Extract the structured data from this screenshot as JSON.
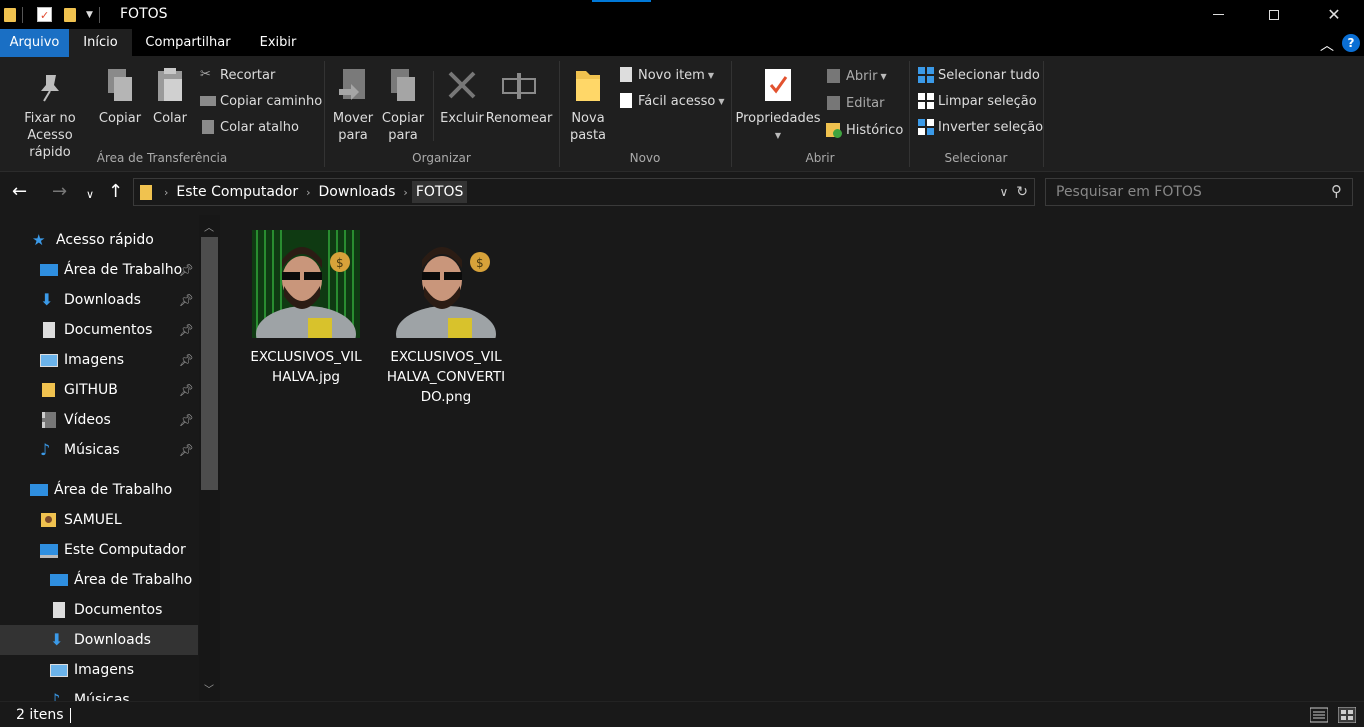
{
  "window": {
    "title": "FOTOS"
  },
  "tabs": [
    {
      "label": "Arquivo"
    },
    {
      "label": "Início"
    },
    {
      "label": "Compartilhar"
    },
    {
      "label": "Exibir"
    }
  ],
  "help_label": "?",
  "ribbon": {
    "clipboard": {
      "label": "Área de Transferência",
      "pin": "Fixar no\nAcesso rápido",
      "copy": "Copiar",
      "paste": "Colar",
      "cut": "Recortar",
      "copy_path": "Copiar caminho",
      "paste_shortcut": "Colar atalho"
    },
    "organize": {
      "label": "Organizar",
      "move_to": "Mover\npara",
      "copy_to": "Copiar\npara",
      "delete": "Excluir",
      "rename": "Renomear"
    },
    "new": {
      "label": "Novo",
      "new_folder": "Nova\npasta",
      "new_item": "Novo item",
      "easy_access": "Fácil acesso"
    },
    "open": {
      "label": "Abrir",
      "properties": "Propriedades",
      "open": "Abrir",
      "edit": "Editar",
      "history": "Histórico"
    },
    "select": {
      "label": "Selecionar",
      "select_all": "Selecionar tudo",
      "select_none": "Limpar seleção",
      "invert": "Inverter seleção"
    }
  },
  "breadcrumb": [
    "Este Computador",
    "Downloads",
    "FOTOS"
  ],
  "search": {
    "placeholder": "Pesquisar em FOTOS"
  },
  "sidebar": {
    "items": [
      {
        "label": "Acesso rápido",
        "icon": "star-icon",
        "pinned": false
      },
      {
        "label": "Área de Trabalho",
        "icon": "desktop-icon",
        "pinned": true
      },
      {
        "label": "Downloads",
        "icon": "download-icon",
        "pinned": true
      },
      {
        "label": "Documentos",
        "icon": "document-icon",
        "pinned": true
      },
      {
        "label": "Imagens",
        "icon": "picture-icon",
        "pinned": true
      },
      {
        "label": "GITHUB",
        "icon": "folder-icon",
        "pinned": true
      },
      {
        "label": "Vídeos",
        "icon": "video-icon",
        "pinned": true
      },
      {
        "label": "Músicas",
        "icon": "music-icon",
        "pinned": true
      },
      {
        "label": "Área de Trabalho",
        "icon": "desktop-icon",
        "pinned": false
      },
      {
        "label": "SAMUEL",
        "icon": "user-folder-icon",
        "pinned": false
      },
      {
        "label": "Este Computador",
        "icon": "computer-icon",
        "pinned": false
      },
      {
        "label": "Área de Trabalho",
        "icon": "desktop-icon",
        "pinned": false
      },
      {
        "label": "Documentos",
        "icon": "document-icon",
        "pinned": false
      },
      {
        "label": "Downloads",
        "icon": "download-icon",
        "pinned": false,
        "selected": true
      },
      {
        "label": "Imagens",
        "icon": "picture-icon",
        "pinned": false
      },
      {
        "label": "Músicas",
        "icon": "music-icon",
        "pinned": false
      }
    ]
  },
  "files": [
    {
      "name": "EXCLUSIVOS_VILHALVA.jpg"
    },
    {
      "name": "EXCLUSIVOS_VILHALVA_CONVERTIDO.png"
    }
  ],
  "status": {
    "item_count": "2 itens"
  },
  "colors": {
    "accent": "#0078d7",
    "background": "#191919",
    "ribbon": "#1f1f1f"
  }
}
